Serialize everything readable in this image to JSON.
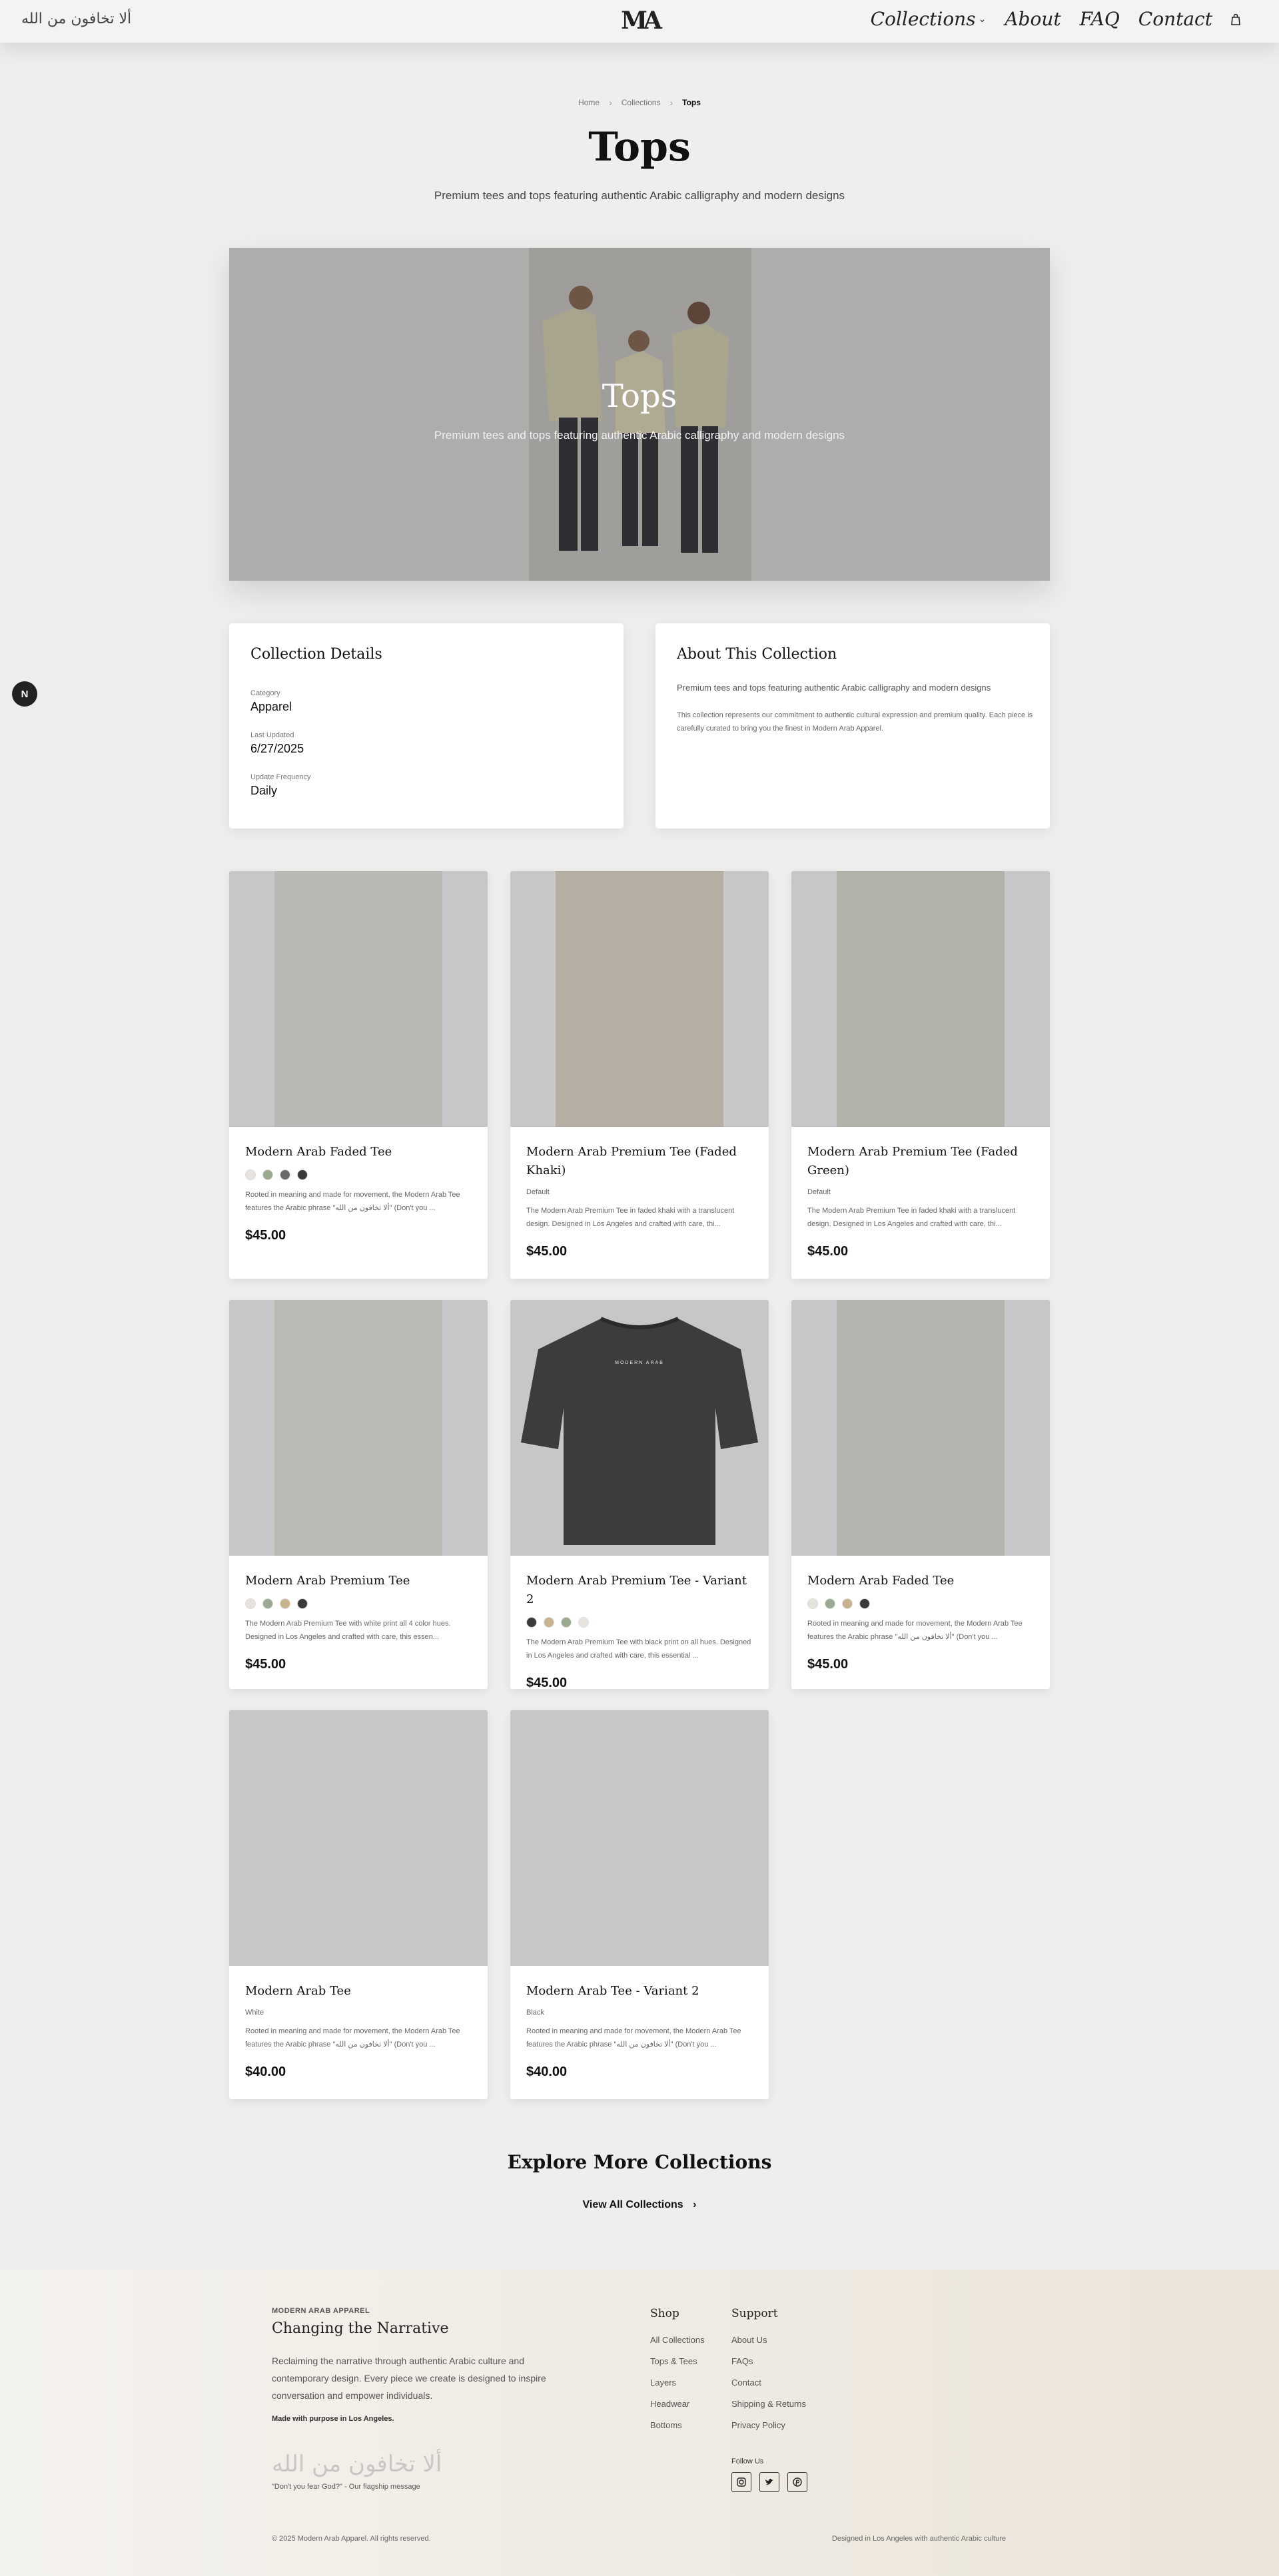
{
  "header": {
    "arabic_text": "ألا تخافون من الله",
    "logo": "MA",
    "nav": [
      {
        "label": "Collections",
        "has_dropdown": true
      },
      {
        "label": "About"
      },
      {
        "label": "FAQ"
      },
      {
        "label": "Contact"
      }
    ]
  },
  "breadcrumb": {
    "home": "Home",
    "collections": "Collections",
    "current": "Tops"
  },
  "page": {
    "title": "Tops",
    "subtitle": "Premium tees and tops featuring authentic Arabic calligraphy and modern designs"
  },
  "banner": {
    "title": "Tops",
    "subtitle": "Premium tees and tops featuring authentic Arabic calligraphy and modern designs"
  },
  "side_button": "N",
  "details": {
    "heading": "Collection Details",
    "category_label": "Category",
    "category_value": "Apparel",
    "updated_label": "Last Updated",
    "updated_value": "6/27/2025",
    "frequency_label": "Update Frequency",
    "frequency_value": "Daily"
  },
  "about": {
    "heading": "About This Collection",
    "lead": "Premium tees and tops featuring authentic Arabic calligraphy and modern designs",
    "body": "This collection represents our commitment to authentic cultural expression and premium quality. Each piece is carefully curated to bring you the finest in Modern Arab Apparel."
  },
  "products": [
    {
      "name": "Modern Arab Faded Tee",
      "swatches": [
        "#e6e3dc",
        "#9aa992",
        "#6b6b6b",
        "#3a3a3a"
      ],
      "variant": "",
      "desc": "Rooted in meaning and made for movement, the Modern Arab Tee features the Arabic phrase \"ألا تخافون من الله\" (Don't you ...",
      "price": "$45.00"
    },
    {
      "name": "Modern Arab Premium Tee (Faded Khaki)",
      "swatches": [],
      "variant": "Default",
      "desc": "The Modern Arab Premium Tee in faded khaki with a translucent design. Designed in Los Angeles and crafted with care, thi...",
      "price": "$45.00"
    },
    {
      "name": "Modern Arab Premium Tee (Faded Green)",
      "swatches": [],
      "variant": "Default",
      "desc": "The Modern Arab Premium Tee in faded khaki with a translucent design. Designed in Los Angeles and crafted with care, thi...",
      "price": "$45.00"
    },
    {
      "name": "Modern Arab Premium Tee",
      "swatches": [
        "#e6e3dc",
        "#9aa992",
        "#c7b48f",
        "#3a3a3a"
      ],
      "variant": "",
      "desc": "The Modern Arab Premium Tee with white print all 4 color hues. Designed in Los Angeles and crafted with care, this essen...",
      "price": "$45.00"
    },
    {
      "name": "Modern Arab Premium Tee - Variant 2",
      "swatches": [
        "#3a3a3a",
        "#c7b48f",
        "#9aa992",
        "#e6e3dc"
      ],
      "variant": "",
      "desc": "The Modern Arab Premium Tee with black print on all hues. Designed in Los Angeles and crafted with care, this essential ...",
      "price": "$45.00"
    },
    {
      "name": "Modern Arab Faded Tee",
      "swatches": [
        "#e6e3dc",
        "#9aa992",
        "#c7b48f",
        "#3a3a3a"
      ],
      "variant": "",
      "desc": "Rooted in meaning and made for movement, the Modern Arab Tee features the Arabic phrase \"ألا تخافون من الله\" (Don't you ...",
      "price": "$45.00"
    },
    {
      "name": "Modern Arab Tee",
      "swatches": [],
      "variant": "White",
      "desc": "Rooted in meaning and made for movement, the Modern Arab Tee features the Arabic phrase \"ألا تخافون من الله\" (Don't you ...",
      "price": "$40.00"
    },
    {
      "name": "Modern Arab Tee - Variant 2",
      "swatches": [],
      "variant": "Black",
      "desc": "Rooted in meaning and made for movement, the Modern Arab Tee features the Arabic phrase \"ألا تخافون من الله\" (Don't you ...",
      "price": "$40.00"
    }
  ],
  "tee_print": "MODERN ARAB",
  "explore": {
    "title": "Explore More Collections",
    "link": "View All Collections"
  },
  "footer": {
    "brand": "MODERN ARAB APPAREL",
    "tagline": "Changing the Narrative",
    "description": "Reclaiming the narrative through authentic Arabic culture and contemporary design. Every piece we create is designed to inspire conversation and empower individuals.",
    "made": "Made with purpose in Los Angeles.",
    "arabic": "ألا تخافون من الله",
    "quote": "\"Don't you fear God?\" - Our flagship message",
    "shop_heading": "Shop",
    "shop_links": [
      "All Collections",
      "Tops & Tees",
      "Layers",
      "Headwear",
      "Bottoms"
    ],
    "support_heading": "Support",
    "support_links": [
      "About Us",
      "FAQs",
      "Contact",
      "Shipping & Returns",
      "Privacy Policy"
    ],
    "follow": "Follow Us",
    "social_icons": [
      "instagram-icon",
      "twitter-icon",
      "pinterest-icon"
    ],
    "copyright": "© 2025 Modern Arab Apparel. All rights reserved.",
    "credit": "Designed in Los Angeles with authentic Arabic culture"
  }
}
